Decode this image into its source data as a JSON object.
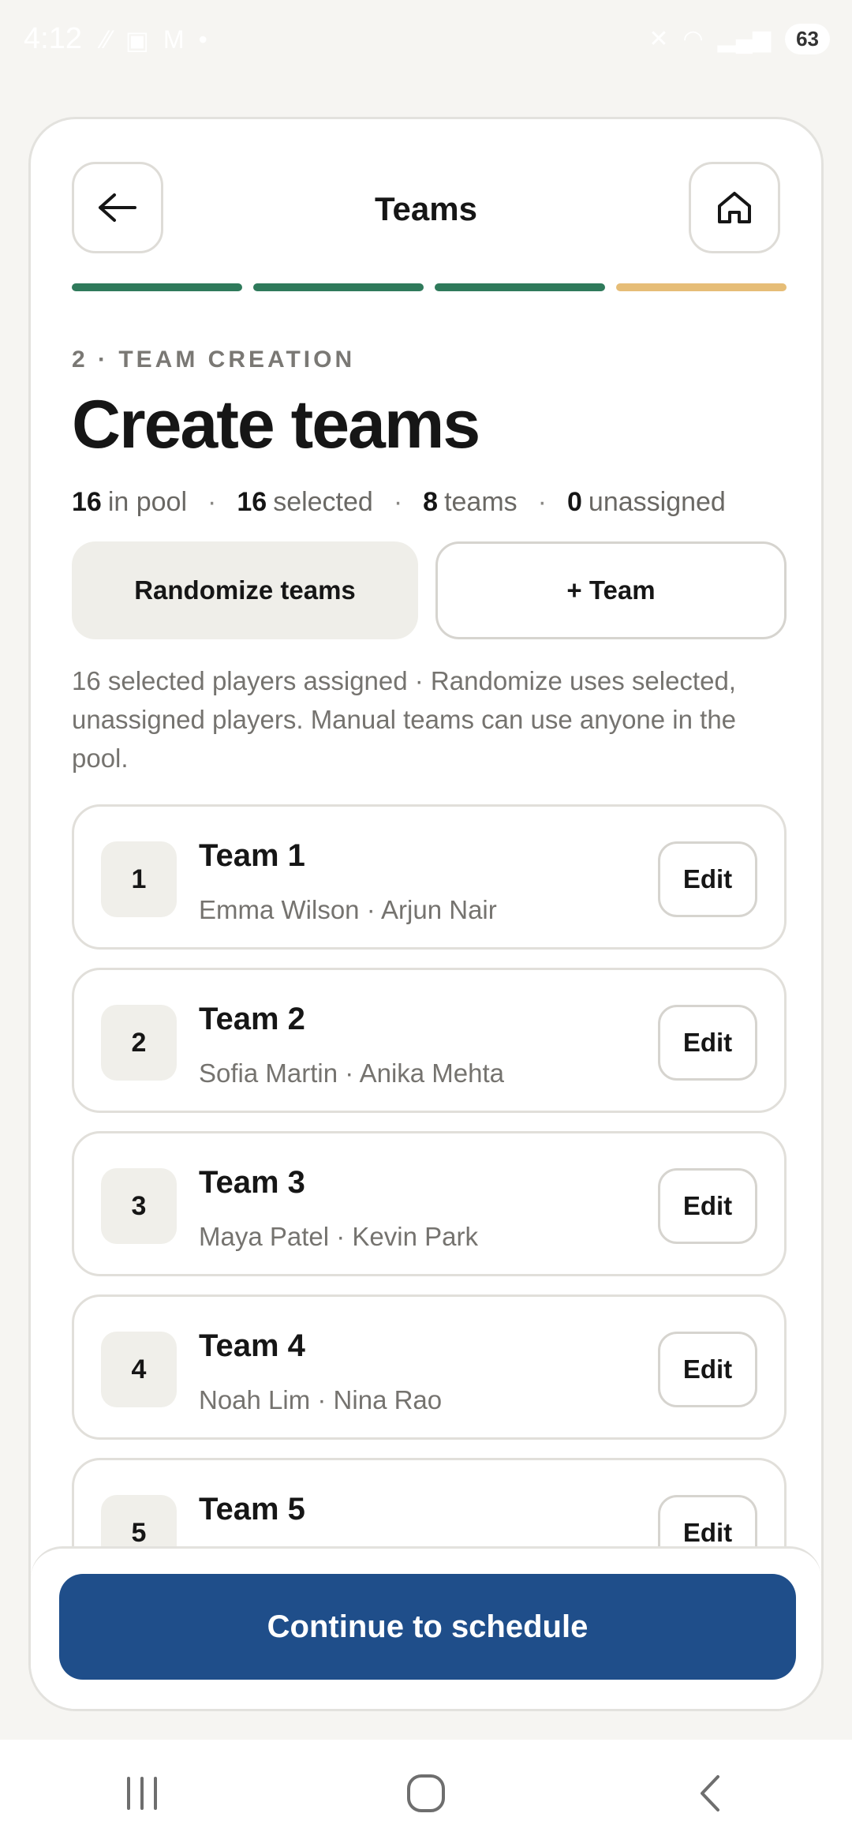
{
  "status_bar": {
    "time": "4:12",
    "battery": "63"
  },
  "header": {
    "title": "Teams"
  },
  "progress": {
    "total_steps": 4,
    "completed_steps": 3,
    "colors": [
      "#2f7a5b",
      "#2f7a5b",
      "#2f7a5b",
      "#e6bd77"
    ]
  },
  "main": {
    "step_label": "2 · TEAM CREATION",
    "title": "Create teams",
    "stats": [
      {
        "value": "16",
        "label": "in pool"
      },
      {
        "value": "16",
        "label": "selected"
      },
      {
        "value": "8",
        "label": "teams"
      },
      {
        "value": "0",
        "label": "unassigned"
      }
    ],
    "randomize_label": "Randomize teams",
    "add_team_label": "+ Team",
    "helper_text": "16 selected players assigned · Randomize uses selected, unassigned players. Manual teams can use anyone in the pool."
  },
  "teams": [
    {
      "number": "1",
      "name": "Team 1",
      "members": "Emma Wilson · Arjun Nair",
      "edit_label": "Edit"
    },
    {
      "number": "2",
      "name": "Team 2",
      "members": "Sofia Martin · Anika Mehta",
      "edit_label": "Edit"
    },
    {
      "number": "3",
      "name": "Team 3",
      "members": "Maya Patel · Kevin Park",
      "edit_label": "Edit"
    },
    {
      "number": "4",
      "name": "Team 4",
      "members": "Noah Lim · Nina Rao",
      "edit_label": "Edit"
    },
    {
      "number": "5",
      "name": "Team 5",
      "members": "",
      "edit_label": "Edit"
    }
  ],
  "footer": {
    "continue_label": "Continue to schedule"
  },
  "colors": {
    "accent": "#1f4e8a",
    "progress_done": "#2f7a5b",
    "progress_current": "#e6bd77"
  },
  "icons": {
    "back": "arrow-left-icon",
    "home": "home-icon",
    "nav_recents": "recents-icon",
    "nav_home": "nav-home-icon",
    "nav_back": "nav-back-icon"
  }
}
